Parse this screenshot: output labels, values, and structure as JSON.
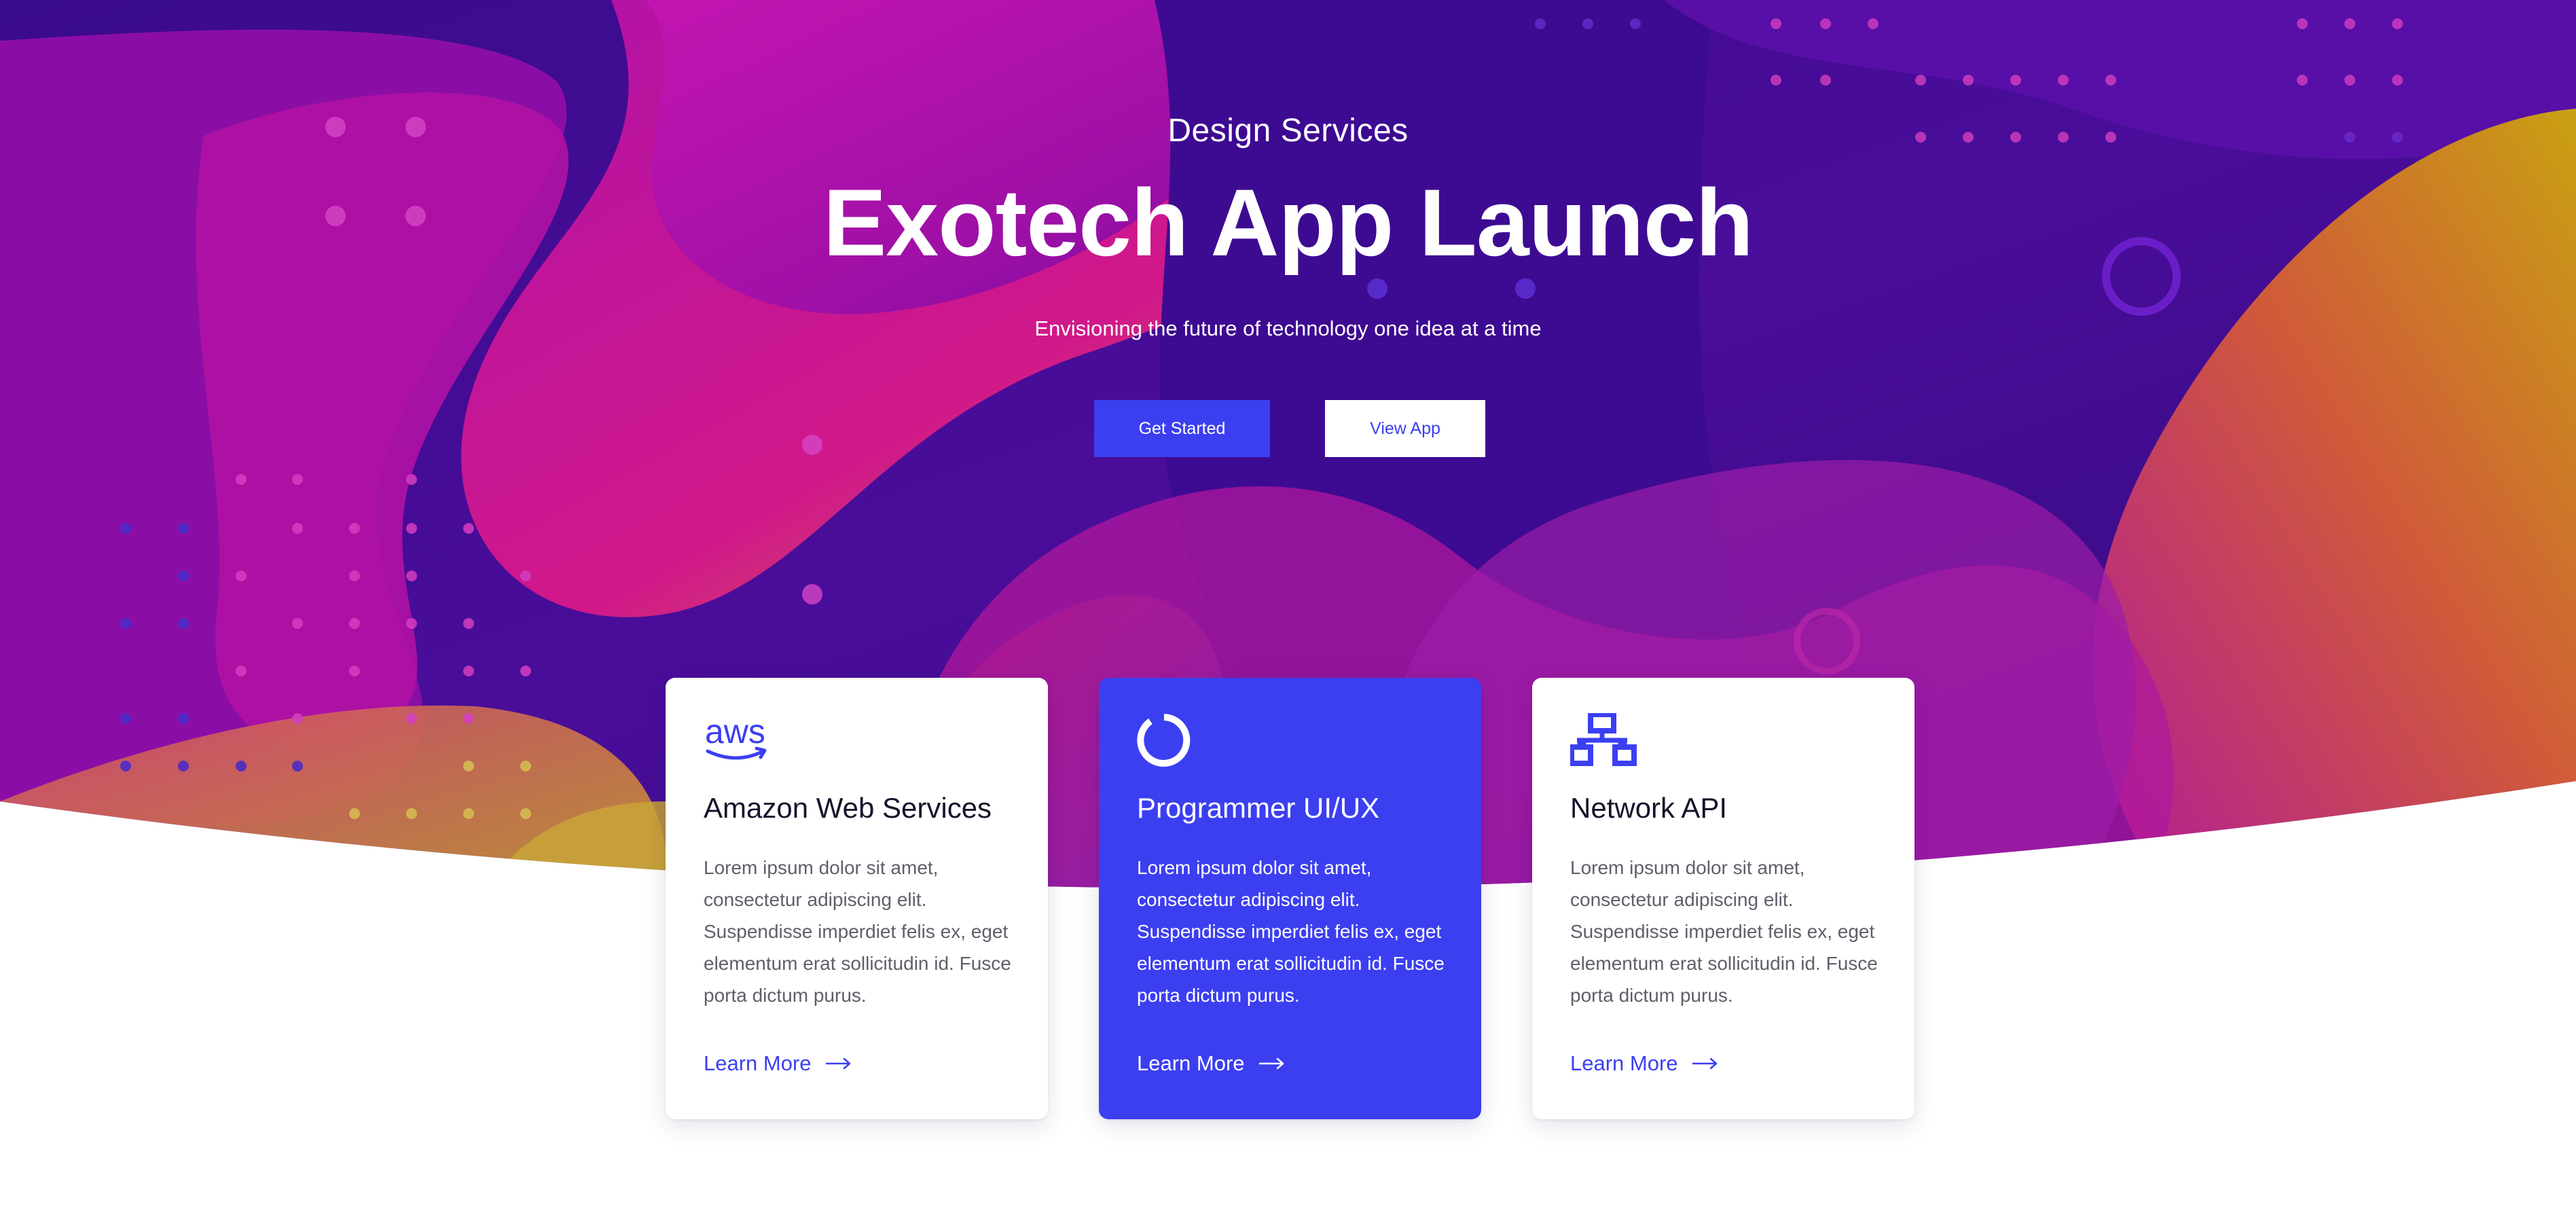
{
  "hero": {
    "eyebrow": "Design Services",
    "title": "Exotech App Launch",
    "subtitle": "Envisioning the future of technology one idea at a time",
    "primary_button": "Get Started",
    "secondary_button": "View App"
  },
  "cards": [
    {
      "icon": "aws-logo-icon",
      "icon_text": "aws",
      "title": "Amazon Web Services",
      "text": "Lorem ipsum dolor sit amet, consectetur adipiscing elit. Suspendisse imperdiet felis ex, eget elementum erat sollicitudin id. Fusce porta dictum purus.",
      "link": "Learn More",
      "active": false
    },
    {
      "icon": "circle-notch-icon",
      "title": "Programmer UI/UX",
      "text": "Lorem ipsum dolor sit amet, consectetur adipiscing elit. Suspendisse imperdiet felis ex, eget elementum erat sollicitudin id. Fusce porta dictum purus.",
      "link": "Learn More",
      "active": true
    },
    {
      "icon": "network-sitemap-icon",
      "title": "Network API",
      "text": "Lorem ipsum dolor sit amet, consectetur adipiscing elit. Suspendisse imperdiet felis ex, eget elementum erat sollicitudin id. Fusce porta dictum purus.",
      "link": "Learn More",
      "active": false
    }
  ],
  "colors": {
    "accent": "#3c3ff0",
    "hero_deep_purple": "#3a0b8c",
    "hero_magenta": "#b8129f",
    "hero_gold": "#c9a012",
    "card_title": "#14142b",
    "card_text": "#5f5f6b"
  }
}
